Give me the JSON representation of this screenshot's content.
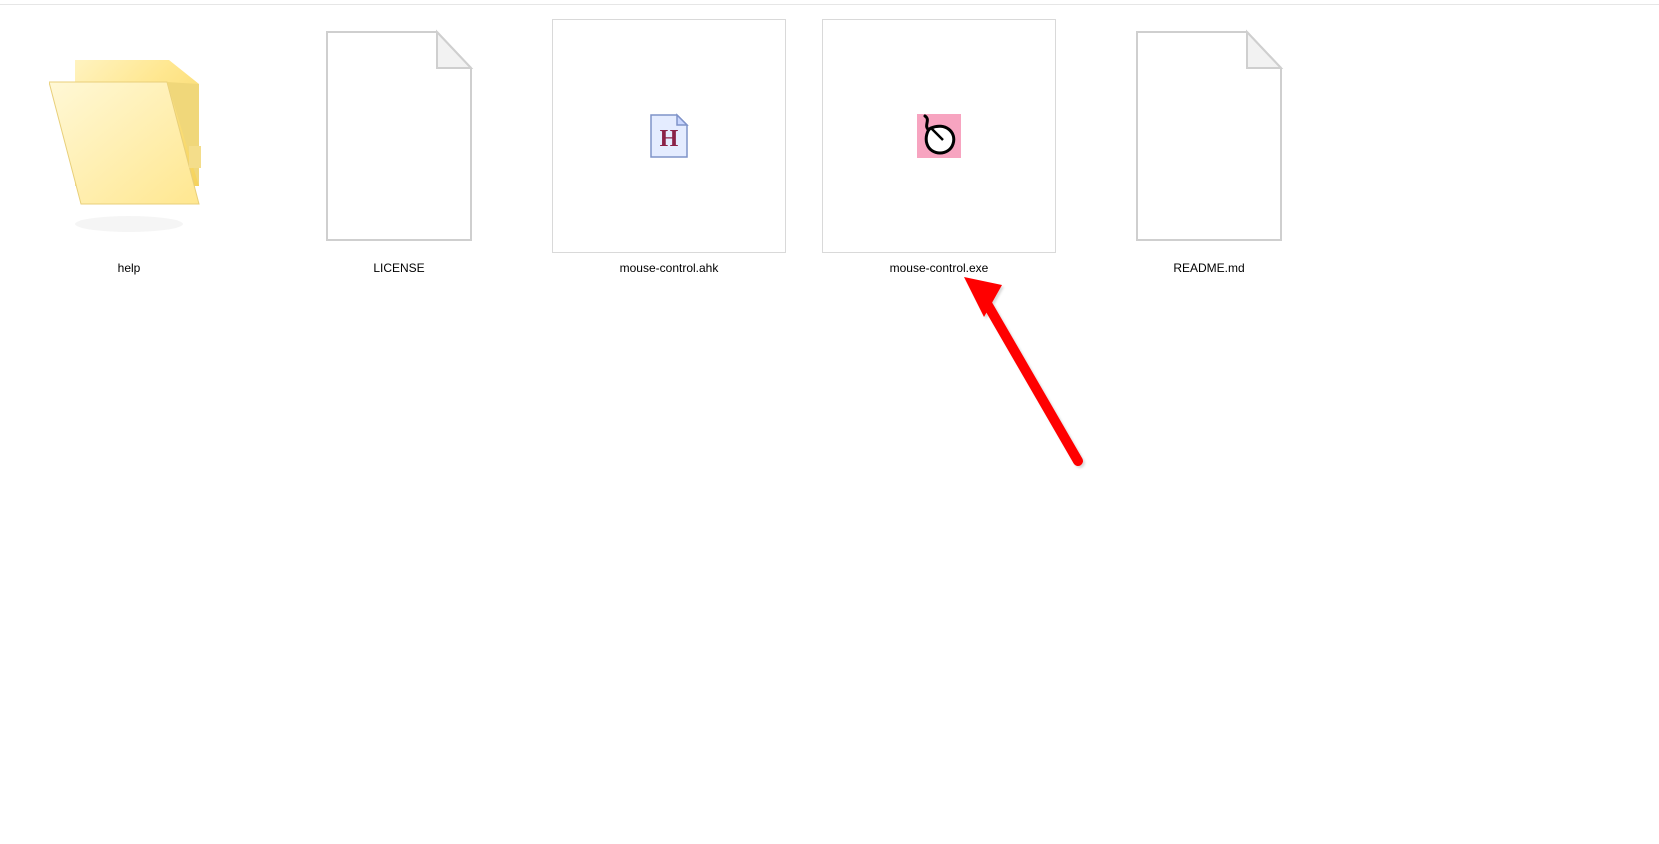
{
  "files": [
    {
      "name": "help",
      "kind": "folder"
    },
    {
      "name": "LICENSE",
      "kind": "file-blank"
    },
    {
      "name": "mouse-control.ahk",
      "kind": "file-ahk"
    },
    {
      "name": "mouse-control.exe",
      "kind": "file-exe"
    },
    {
      "name": "README.md",
      "kind": "file-blank"
    }
  ],
  "annotation": {
    "target_label": "mouse-control.exe",
    "arrow_color": "#ff0000"
  }
}
